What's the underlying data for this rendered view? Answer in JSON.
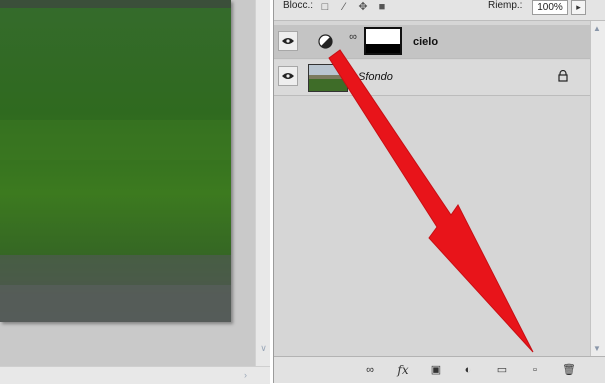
{
  "panel": {
    "lock_label": "Blocc.:",
    "fill_label": "Riemp.:",
    "fill_value": "100%",
    "icons": [
      "lock-transparency-icon",
      "lock-brush-icon",
      "lock-move-icon",
      "lock-all-icon"
    ]
  },
  "layers": [
    {
      "name": "cielo",
      "type": "adjustment-with-mask",
      "selected": true
    },
    {
      "name": "Sfondo",
      "type": "background",
      "locked": true,
      "selected": false
    }
  ],
  "footer": {
    "fx_label": "fx",
    "icons": [
      "link-layers-icon",
      "fx-icon",
      "add-mask-icon",
      "adjustment-layer-icon",
      "new-group-icon",
      "new-layer-icon",
      "trash-icon"
    ]
  },
  "colors": {
    "annotation_arrow": "#e8141a",
    "panel_bg": "#d6d6d6",
    "selected_row": "#c4c4c4",
    "grass": "#2f6a1f"
  }
}
